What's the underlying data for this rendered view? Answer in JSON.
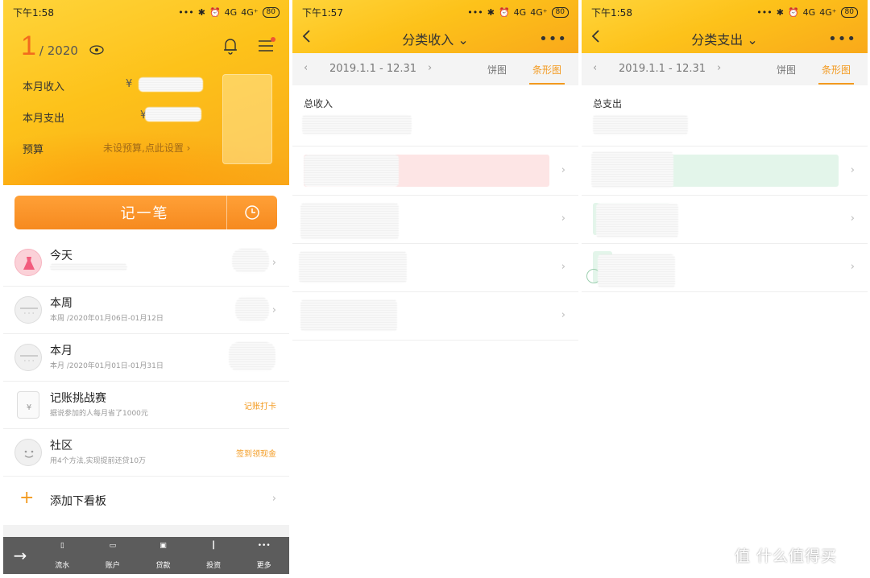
{
  "screen1": {
    "status": {
      "time": "下午1:58",
      "net1": "4G",
      "net2": "4G⁺",
      "battery": "80"
    },
    "header": {
      "month": "1",
      "year": "/ 2020"
    },
    "rows": [
      {
        "label": "本月收入",
        "value": "¥"
      },
      {
        "label": "本月支出",
        "value": "¥"
      },
      {
        "label": "预算",
        "value": "未设预算,点此设置 ›"
      }
    ],
    "record_label": "记一笔",
    "list": [
      {
        "title": "今天",
        "sub": ""
      },
      {
        "title": "本周",
        "sub": "本周 /2020年01月06日-01月12日"
      },
      {
        "title": "本月",
        "sub": "本月 /2020年01月01日-01月31日"
      },
      {
        "title": "记账挑战赛",
        "sub": "据说参加的人每月省了1000元",
        "action": "记账打卡"
      },
      {
        "title": "社区",
        "sub": "用4个方法,实现提前还贷10万",
        "action": "签到领现金"
      },
      {
        "title": "添加下看板"
      }
    ],
    "tabs": [
      "流水",
      "账户",
      "贷款",
      "投资",
      "更多"
    ]
  },
  "screen2": {
    "status": {
      "time": "下午1:57",
      "net1": "4G",
      "net2": "4G⁺",
      "battery": "80"
    },
    "title": "分类收入",
    "range": "2019.1.1 - 12.31",
    "tabs": [
      "饼图",
      "条形图"
    ],
    "total_label": "总收入",
    "bar_color": "#fde5e5"
  },
  "screen3": {
    "status": {
      "time": "下午1:58",
      "net1": "4G",
      "net2": "4G⁺",
      "battery": "80"
    },
    "title": "分类支出",
    "range": "2019.1.1 - 12.31",
    "tabs": [
      "饼图",
      "条形图"
    ],
    "total_label": "总支出",
    "bar_color": "#e3f5ea"
  },
  "watermark": "值 什么值得买"
}
